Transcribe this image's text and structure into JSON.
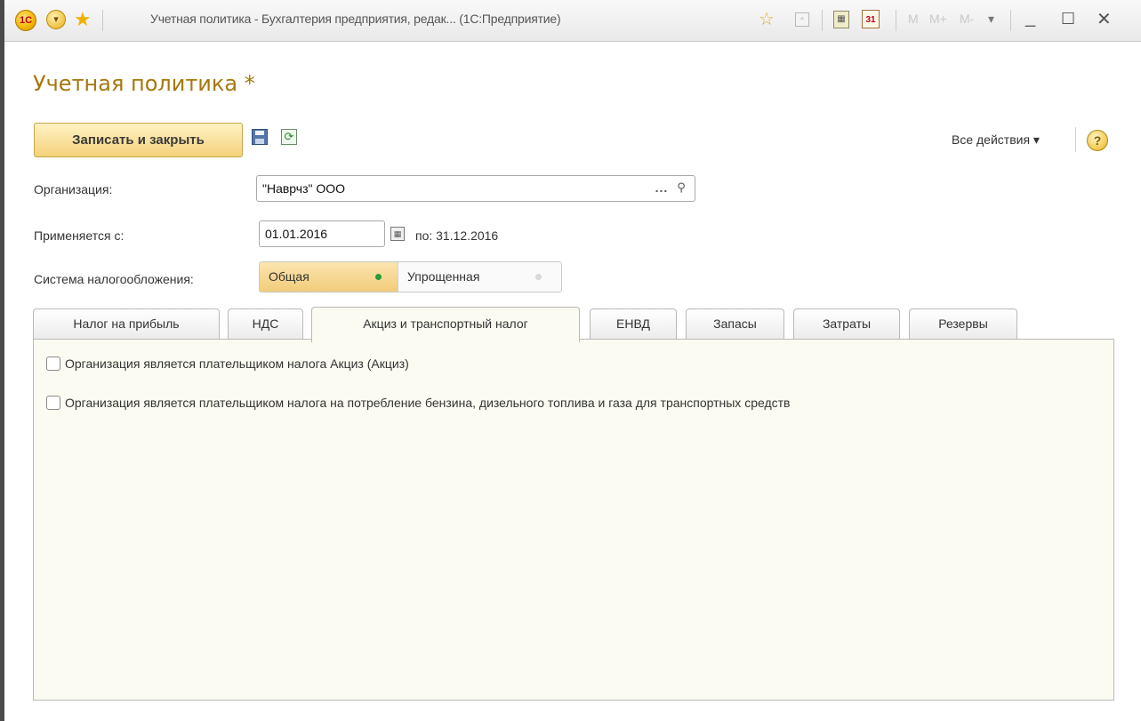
{
  "window": {
    "title": "Учетная политика - Бухгалтерия предприятия, редак... (1С:Предприятие)",
    "logo_text": "1С",
    "m_buttons": [
      "M",
      "M+",
      "M-"
    ],
    "controls": {
      "minimize": "_",
      "maximize": "☐",
      "close": "✕"
    }
  },
  "page": {
    "title": "Учетная политика *"
  },
  "toolbar": {
    "save_close": "Записать и закрыть",
    "all_actions": "Все действия ▾",
    "help": "?"
  },
  "form": {
    "organization": {
      "label": "Организация:",
      "value": "\"Наврчз\" ООО",
      "select": "...",
      "open": "🔍"
    },
    "applies_from": {
      "label": "Применяется с:",
      "value": "01.01.2016",
      "to_text": "по: 31.12.2016"
    },
    "tax_system": {
      "label": "Система налогообложения:",
      "options": [
        "Общая",
        "Упрощенная"
      ],
      "selected": "Общая"
    }
  },
  "tabs": [
    {
      "label": "Налог на прибыль"
    },
    {
      "label": "НДС"
    },
    {
      "label": "Акциз и транспортный налог"
    },
    {
      "label": "ЕНВД"
    },
    {
      "label": "Запасы"
    },
    {
      "label": "Затраты"
    },
    {
      "label": "Резервы"
    }
  ],
  "active_tab": "Акциз и транспортный налог",
  "panel": {
    "checkboxes": [
      {
        "label": "Организация является плательщиком налога Акциз (Акциз)",
        "checked": false
      },
      {
        "label": "Организация является плательщиком налога на потребление бензина, дизельного топлива и газа для транспортных средств",
        "checked": false
      }
    ]
  },
  "colors": {
    "title": "#a8770d",
    "accent": "#f4d27a",
    "panel_bg": "#fbfbf2"
  }
}
